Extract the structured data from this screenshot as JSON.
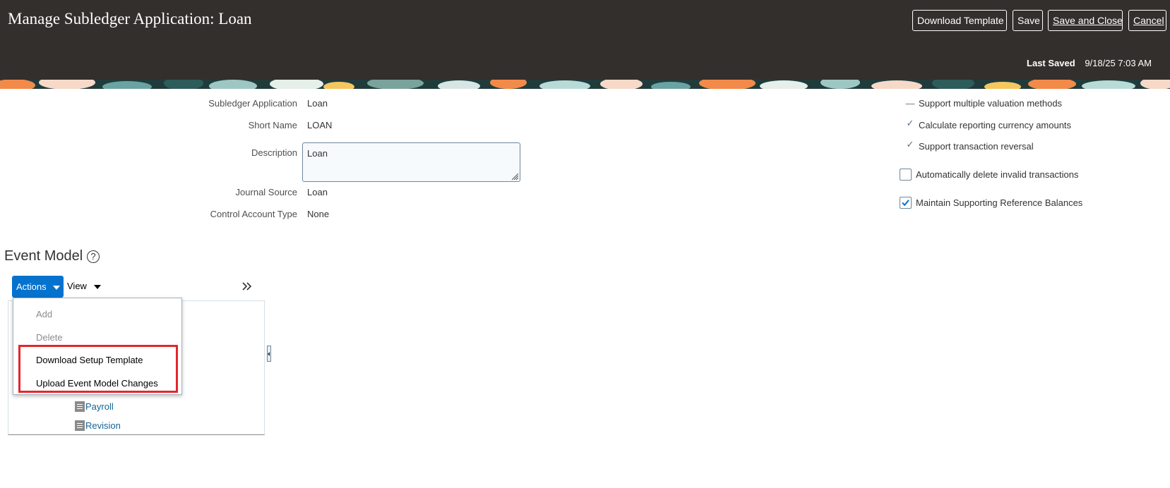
{
  "header": {
    "title": "Manage Subledger Application: Loan",
    "buttons": {
      "download_template": "Download Template",
      "save": "Save",
      "save_and_close": "Save and Close",
      "cancel": "Cancel"
    },
    "last_saved_label": "Last Saved",
    "last_saved_value": "9/18/25 7:03 AM"
  },
  "form": {
    "subledger_application": {
      "label": "Subledger Application",
      "value": "Loan"
    },
    "short_name": {
      "label": "Short Name",
      "value": "LOAN"
    },
    "description": {
      "label": "Description",
      "value": "Loan"
    },
    "journal_source": {
      "label": "Journal Source",
      "value": "Loan"
    },
    "control_account_type": {
      "label": "Control Account Type",
      "value": "None"
    }
  },
  "options": {
    "support_multiple_valuation": {
      "label": "Support multiple valuation methods",
      "state": "unchecked"
    },
    "calculate_reporting_currency": {
      "label": "Calculate reporting currency amounts",
      "state": "checked"
    },
    "support_transaction_reversal": {
      "label": "Support transaction reversal",
      "state": "checked"
    },
    "auto_delete_invalid": {
      "label": "Automatically delete invalid transactions",
      "checked": false
    },
    "maintain_supporting_reference": {
      "label": "Maintain Supporting Reference Balances",
      "checked": true
    }
  },
  "event_model": {
    "title": "Event Model",
    "toolbar": {
      "actions": "Actions",
      "view": "View"
    },
    "actions_menu": [
      {
        "label": "Add",
        "enabled": false
      },
      {
        "label": "Delete",
        "enabled": false
      },
      {
        "label": "Download Setup Template",
        "enabled": true
      },
      {
        "label": "Upload Event Model Changes",
        "enabled": true
      }
    ],
    "tree_nodes": [
      "Payroll",
      "Revision"
    ]
  },
  "colors": {
    "header_bg": "#332f2c",
    "accent_blue": "#0572ce",
    "highlight_red": "#e3262e",
    "link_blue": "#146594"
  }
}
